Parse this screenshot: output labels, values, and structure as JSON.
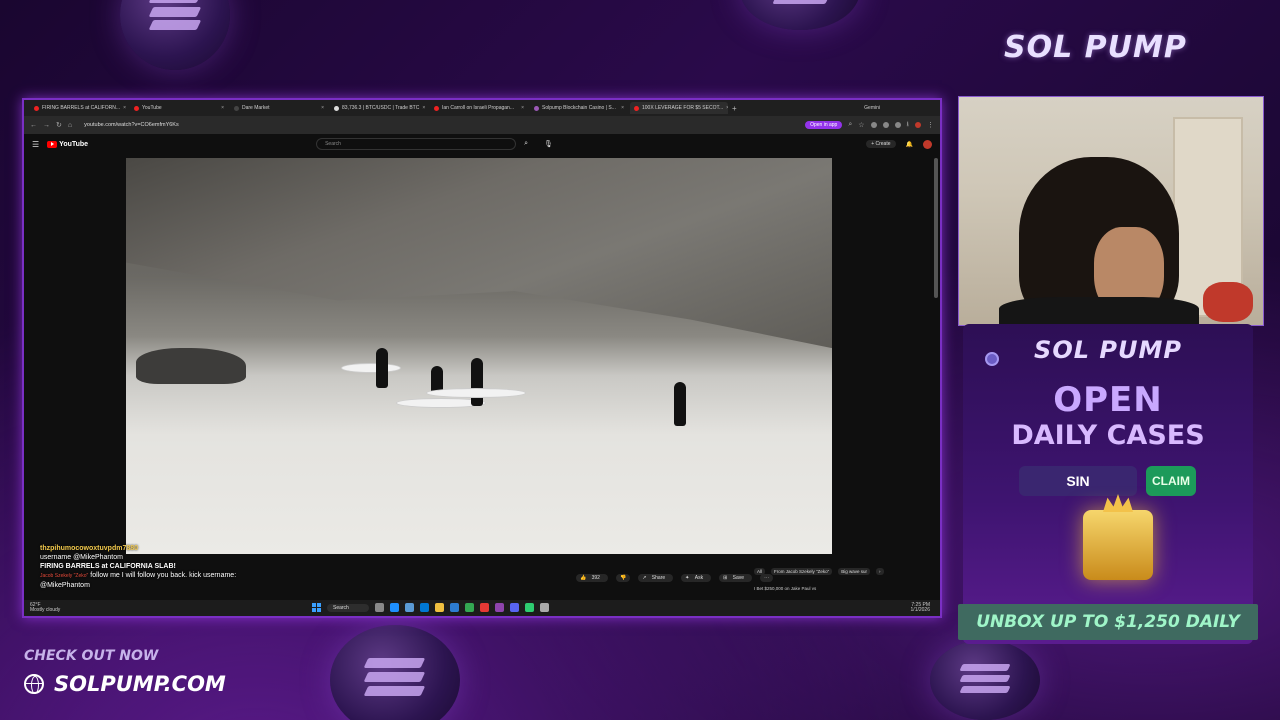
{
  "browser": {
    "tabs": [
      {
        "label": "FIRING BARRELS at CALIFORN...",
        "active": false
      },
      {
        "label": "YouTube",
        "active": false
      },
      {
        "label": "Dare Market",
        "active": false
      },
      {
        "label": "83,736.3 | BTC/USDC | Trade BTC",
        "active": false
      },
      {
        "label": "Ian Carroll on Israeli Propagan...",
        "active": false
      },
      {
        "label": "Solpump Blockchain Casino | S...",
        "active": false
      },
      {
        "label": "100X LEVERAGE FOR $5 SECOT...",
        "active": true
      }
    ],
    "gemini_label": "Gemini",
    "url": "youtube.com/watch?v=CO6emfmY6Ks",
    "open_in_app": "Open in app"
  },
  "youtube": {
    "logo_text": "YouTube",
    "search_placeholder": "Search",
    "create_label": "Create",
    "actions": {
      "likes": "392",
      "share": "Share",
      "ask": "Ask",
      "save": "Save"
    },
    "chips": [
      "All",
      "From Jacob Szekely \"Zeko\"",
      "Big wave sur"
    ],
    "related_title": "I Bet $250,000 on Jake Paul vs"
  },
  "chat": {
    "user1": "thzpihumocowoxtuvpdm7880",
    "line1": "username @MikePhantom",
    "line2": "FIRING BARRELS at CALIFORNIA SLAB!",
    "line3_prefix": "Jacob Szekely \"Zeko\"",
    "line3": "follow me I will follow you back. kick username:",
    "line4": "@MikePhantom"
  },
  "taskbar": {
    "weather_temp": "62°F",
    "weather_desc": "Mostly cloudy",
    "search_label": "Search",
    "time": "7:25 PM",
    "date": "1/1/2026"
  },
  "overlay": {
    "main_logo": "SOL PUMP",
    "promo_logo": "SOL PUMP",
    "open_text": "OPEN",
    "daily_cases": "DAILY CASES",
    "code_value": "SIN",
    "claim_label": "CLAIM",
    "banner": "UNBOX UP TO $1,250 DAILY",
    "checkout": "CHECK OUT NOW",
    "site": "SOLPUMP.COM"
  },
  "colors": {
    "accent_purple": "#7a2fc4",
    "claim_green": "#1c9a5a",
    "banner_text": "#9ff5c8"
  }
}
